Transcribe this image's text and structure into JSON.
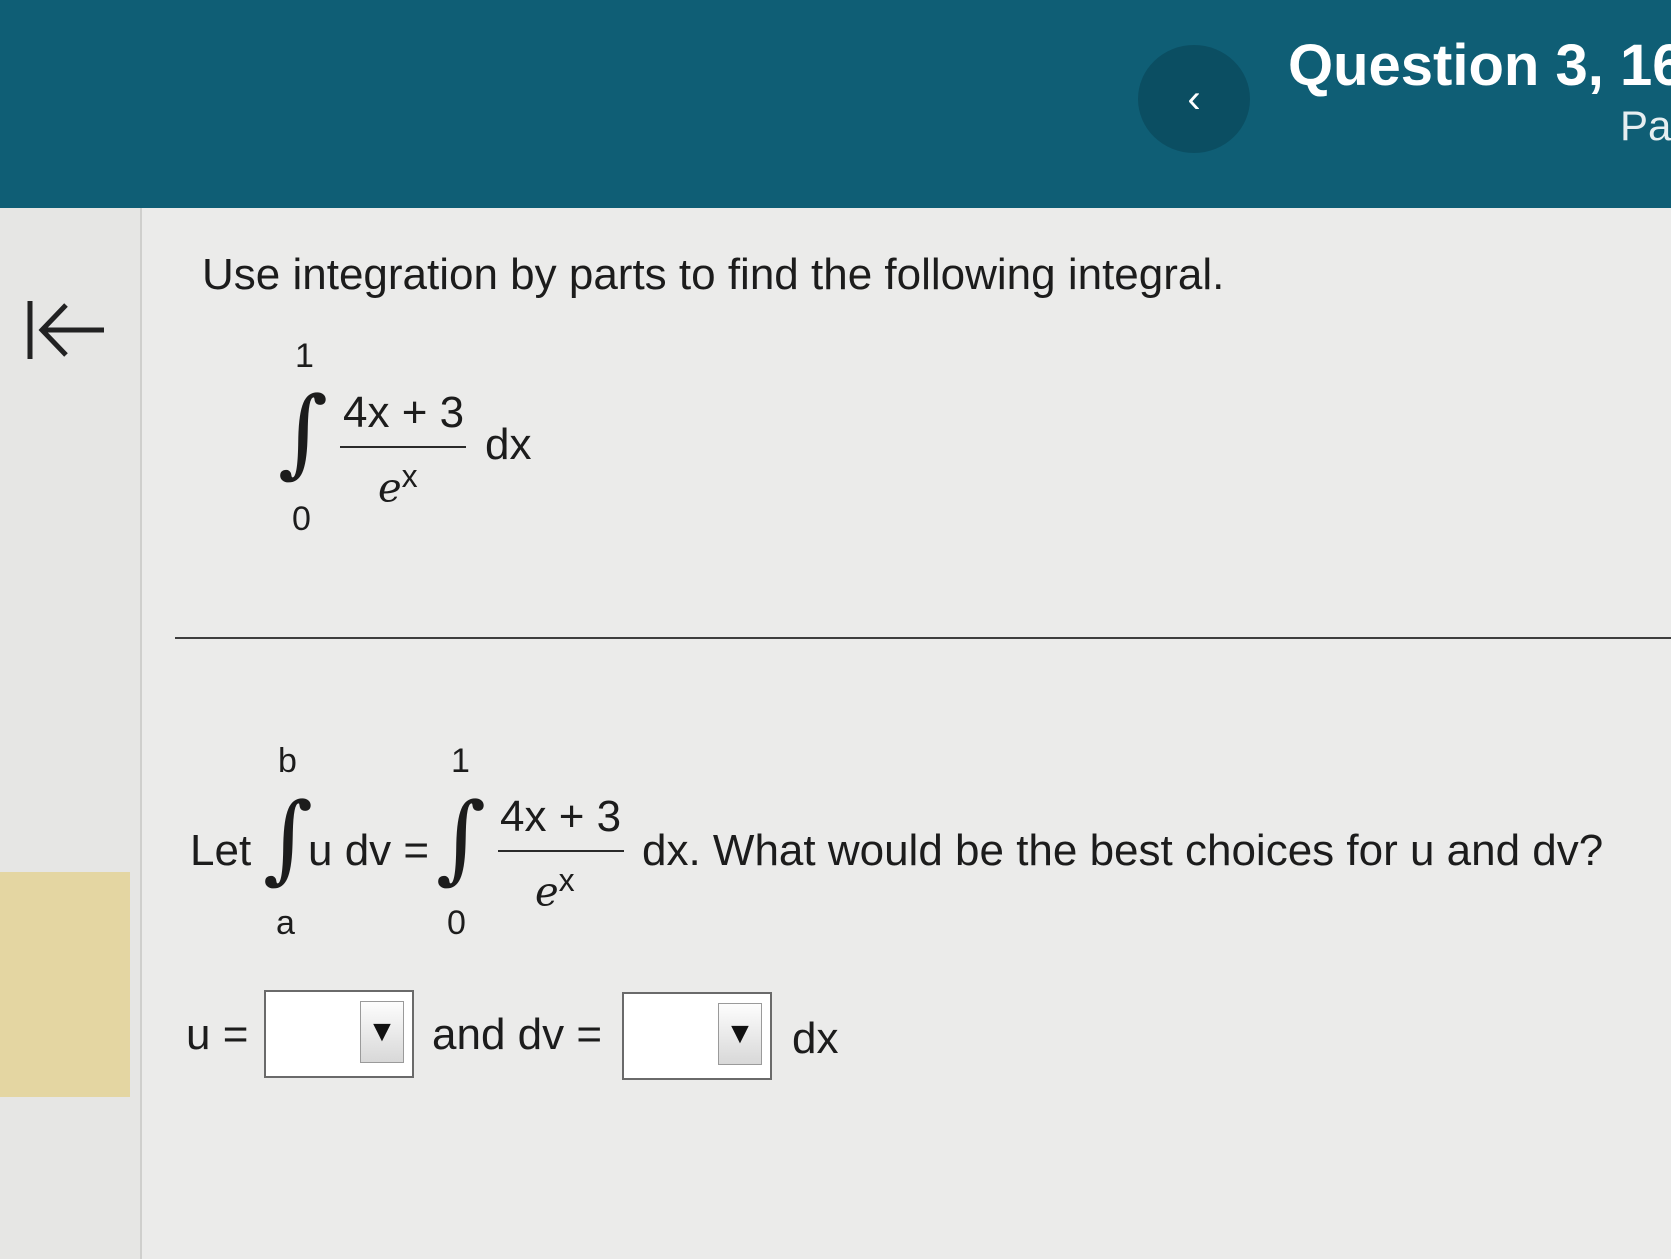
{
  "header": {
    "back_icon": "chevron-left-icon",
    "back_glyph": "‹",
    "question_title": "Question 3, 16",
    "question_sub": "Pa"
  },
  "sidebar": {
    "collapse_icon": "collapse-left-icon"
  },
  "problem": {
    "prompt": "Use integration by parts to find the following integral.",
    "integral": {
      "upper": "1",
      "lower": "0",
      "numerator": "4x + 3",
      "denominator_base": "e",
      "denominator_exp": "x",
      "differential": "dx"
    }
  },
  "question": {
    "let": "Let",
    "lhs_upper": "b",
    "lhs_lower": "a",
    "lhs_integrand": "u dv =",
    "rhs_upper": "1",
    "rhs_lower": "0",
    "rhs_numerator": "4x + 3",
    "rhs_denominator_base": "e",
    "rhs_denominator_exp": "x",
    "suffix": "dx. What would be the best choices for u and dv?"
  },
  "answer": {
    "u_label": "u =",
    "u_value": "",
    "and_label": "and dv =",
    "dv_value": "",
    "dx_label": "dx",
    "dropdown_arrow": "▼"
  }
}
